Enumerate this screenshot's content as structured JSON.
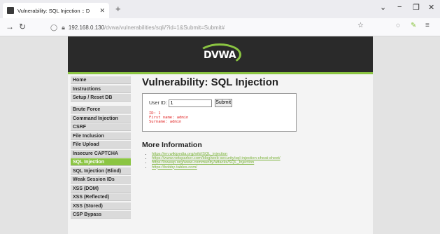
{
  "browser": {
    "tab_title": "Vulnerability: SQL Injection :: D",
    "tab_close": "✕",
    "new_tab": "+",
    "window_minimize": "−",
    "window_maximize": "❐",
    "window_close": "✕",
    "url_host": "192.168.0.130",
    "url_path": "/dvwa/vulnerabilities/sqli/?id=1&Submit=Submit#"
  },
  "header": {
    "logo_text": "DVWA"
  },
  "menu": {
    "group1": [
      "Home",
      "Instructions",
      "Setup / Reset DB"
    ],
    "group2": [
      "Brute Force",
      "Command Injection",
      "CSRF",
      "File Inclusion",
      "File Upload",
      "Insecure CAPTCHA",
      "SQL Injection",
      "SQL Injection (Blind)",
      "Weak Session IDs",
      "XSS (DOM)",
      "XSS (Reflected)",
      "XSS (Stored)",
      "CSP Bypass"
    ],
    "active": "SQL Injection"
  },
  "main": {
    "title": "Vulnerability: SQL Injection",
    "form": {
      "label": "User ID:",
      "value": "1",
      "submit_label": "Submit"
    },
    "result": {
      "line1": "ID: 1",
      "line2": "First name: admin",
      "line3": "Surname: admin"
    },
    "more_info_title": "More Information",
    "links": [
      "https://en.wikipedia.org/wiki/SQL_injection",
      "https://www.netsparker.com/blog/web-security/sql-injection-cheat-sheet/",
      "https://owasp.org/www-community/attacks/SQL_Injection",
      "https://bobby-tables.com/"
    ]
  },
  "colors": {
    "accent": "#8bc542",
    "header": "#2a2a2a",
    "result": "#e02020"
  }
}
